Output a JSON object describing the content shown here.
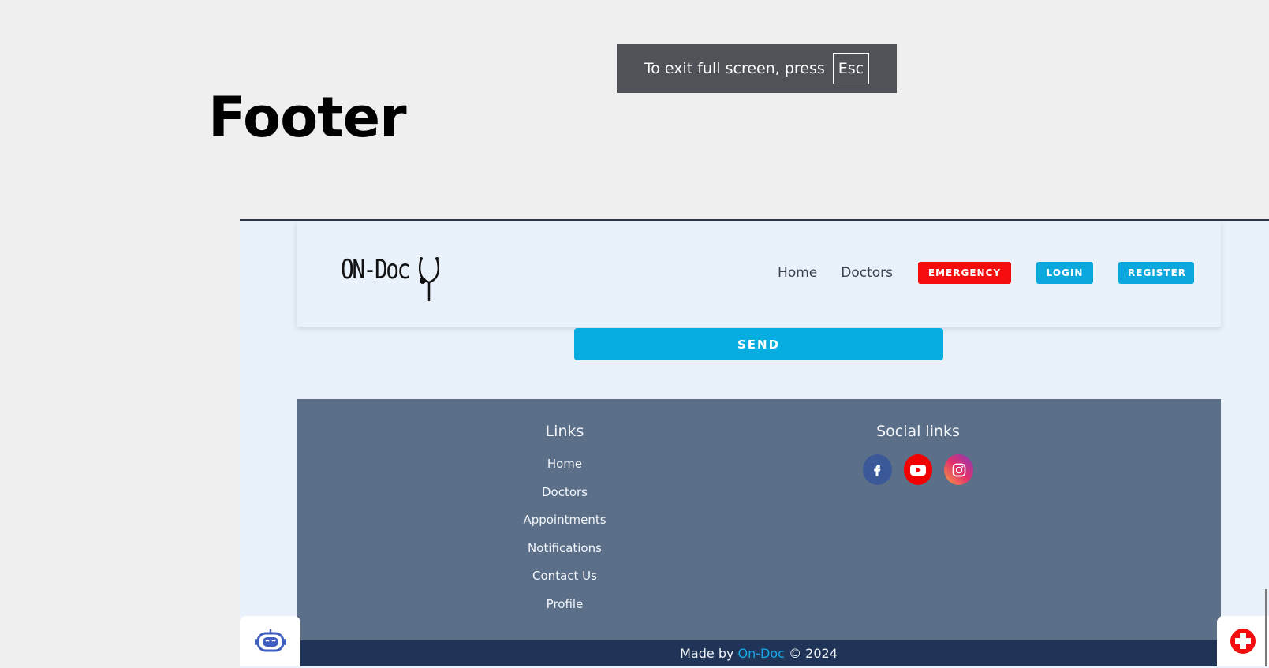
{
  "slide": {
    "title": "Footer"
  },
  "fullscreen_toast": {
    "text": "To exit full screen, press",
    "key": "Esc"
  },
  "navbar": {
    "logo_text": "ON-Doc",
    "links": [
      "Home",
      "Doctors"
    ],
    "emergency_label": "EMERGENCY",
    "login_label": "LOGIN",
    "register_label": "REGISTER"
  },
  "form": {
    "send_label": "SEND"
  },
  "footer": {
    "links_title": "Links",
    "links": [
      "Home",
      "Doctors",
      "Appointments",
      "Notifications",
      "Contact Us",
      "Profile"
    ],
    "social_title": "Social links",
    "social": [
      "facebook-icon",
      "youtube-icon",
      "instagram-icon"
    ]
  },
  "copyright": {
    "prefix": "Made by",
    "brand": "On-Doc",
    "suffix": "© 2024"
  },
  "colors": {
    "emergency": "#f40d0d",
    "accent": "#0aa8dc",
    "footer_bg": "#5c6f88",
    "copyright_bg": "#1f3457"
  }
}
